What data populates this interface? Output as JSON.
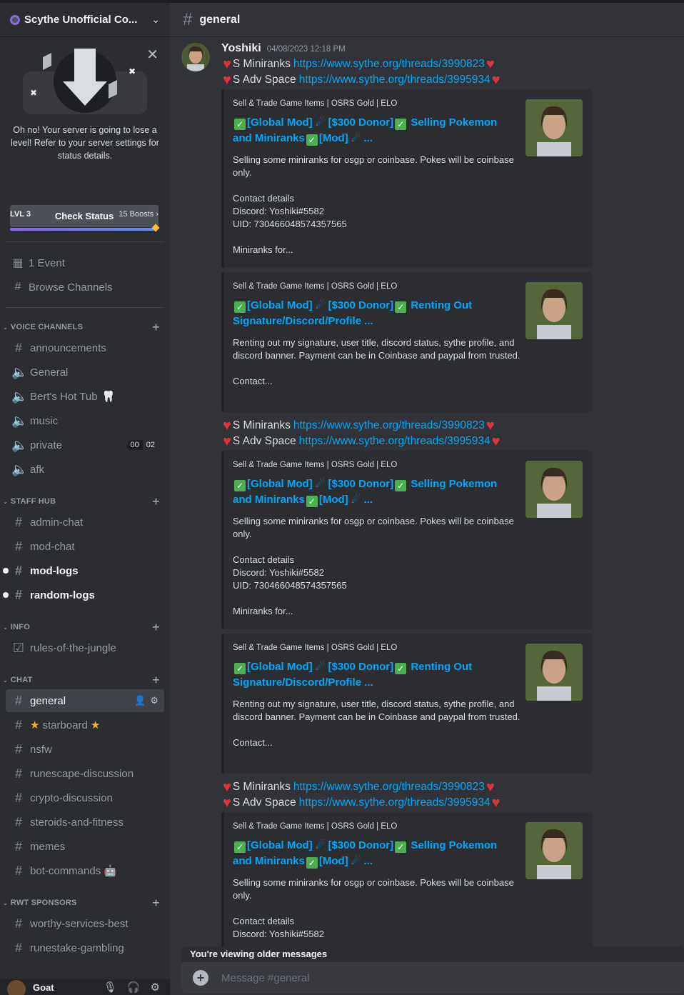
{
  "server": {
    "name": "Scythe Unofficial Co..."
  },
  "boost": {
    "text": "Oh no! Your server is going to lose a level! Refer to your server settings for status details.",
    "check_status": "Check Status",
    "level": "LVL 3",
    "boosts": "15 Boosts",
    "progress": 0.97
  },
  "nav": {
    "events": "1 Event",
    "browse": "Browse Channels"
  },
  "categories": {
    "voice": "VOICE CHANNELS",
    "staff": "STAFF HUB",
    "info": "INFO",
    "chat": "CHAT",
    "sponsors": "RWT SPONSORS"
  },
  "channels": {
    "announcements": "announcements",
    "general_voice": "General",
    "berts": "Bert's Hot Tub",
    "berts_emoji": "🦷",
    "music": "music",
    "private": "private",
    "private_count_a": "00",
    "private_count_b": "02",
    "afk": "afk",
    "admin_chat": "admin-chat",
    "mod_chat": "mod-chat",
    "mod_logs": "mod-logs",
    "random_logs": "random-logs",
    "rules": "rules-of-the-jungle",
    "general": "general",
    "starboard": "starboard",
    "star": "★",
    "nsfw": "nsfw",
    "runescape": "runescape-discussion",
    "crypto": "crypto-discussion",
    "steroids": "steroids-and-fitness",
    "memes": "memes",
    "bot_commands": "bot-commands",
    "bot_emoji": "🤖",
    "worthy": "worthy-services-best",
    "runestake": "runestake-gambling"
  },
  "user": {
    "name": "Goat"
  },
  "header": {
    "channel": "general"
  },
  "message": {
    "author": "Yoshiki",
    "timestamp": "04/08/2023 12:18 PM"
  },
  "promo": {
    "miniranks_label": "S Miniranks",
    "miniranks_link": "https://www.sythe.org/threads/3990823",
    "adv_label": "S Adv Space",
    "adv_link": "https://www.sythe.org/threads/3995934"
  },
  "embeds": {
    "provider": "Sell & Trade Game Items | OSRS Gold | ELO",
    "tag_global": "[Global Mod]",
    "tag_donor": "[$300 Donor]",
    "tag_mod": "[Mod]",
    "pokemon_title_a": "Selling Pokemon",
    "pokemon_title_b": "and Miniranks",
    "pokemon_desc": "Selling some miniranks for osgp or coinbase. Pokes will be coinbase only.",
    "pokemon_contact": "Contact details",
    "pokemon_discord": "Discord: Yoshiki#5582",
    "pokemon_uid": "UID: 730466048574357565",
    "pokemon_more": "Miniranks for...",
    "renting_title_a": "Renting Out",
    "renting_title_b": "Signature/Discord/Profile ...",
    "renting_desc": "Renting out my signature, user title, discord status, sythe profile, and discord banner. Payment can be in Coinbase and paypal from trusted.",
    "renting_more": "Contact...",
    "ellipsis": "..."
  },
  "composer": {
    "older": "You're viewing older messages",
    "placeholder": "Message #general"
  }
}
